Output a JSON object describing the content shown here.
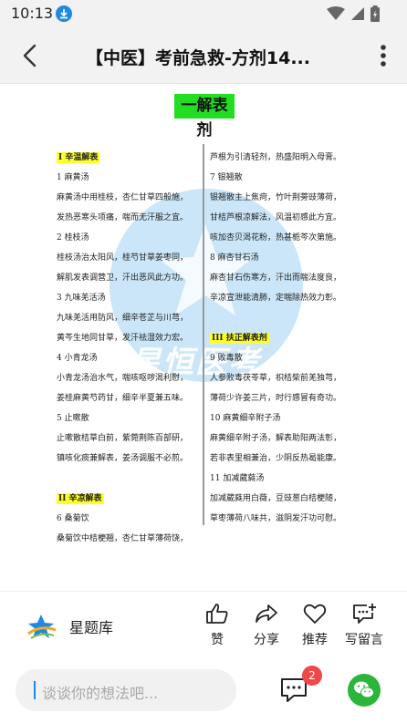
{
  "status_bar": {
    "time": "10:13"
  },
  "header": {
    "title": "【中医】考前急救-方剂14..."
  },
  "document": {
    "heading": "一解表剂",
    "watermark": "星恒医考",
    "left_column": [
      {
        "text": "I 辛温解表",
        "highlight": true
      },
      {
        "text": "1 麻黄汤"
      },
      {
        "text": "麻黄汤中用桂枝，杏仁甘草四般施，"
      },
      {
        "text": "发热恶寒头项痛，喘而无汗服之宜。"
      },
      {
        "text": "2 桂枝汤"
      },
      {
        "text": "桂枝汤治太阳风，桂芍甘草姜枣同，"
      },
      {
        "text": "解肌发表调营卫，汗出恶风此方功。"
      },
      {
        "text": "3 九味羌活汤"
      },
      {
        "text": "九味羌活用防风，细辛苍芷与川芎，"
      },
      {
        "text": "黄芩生地同甘草，发汗祛湿效力宏。"
      },
      {
        "text": "4 小青龙汤"
      },
      {
        "text": "小青龙汤治水气，喘咳呕哕渴利慰，"
      },
      {
        "text": "姜桂麻黄芍药甘，细辛半夏兼五味。"
      },
      {
        "text": "5 止嗽散"
      },
      {
        "text": "止嗽散桔草白前，紫菀荆陈百部研，"
      },
      {
        "text": "镇咳化痰兼解表，姜汤调服不必煎。"
      },
      {
        "text": "",
        "spacer": true
      },
      {
        "text": "II 辛凉解表",
        "highlight": true
      },
      {
        "text": "6 桑菊饮"
      },
      {
        "text": "桑菊饮中桔梗翘，杏仁甘草薄荷饶，"
      }
    ],
    "right_column": [
      {
        "text": "芦根为引清轻剂，热盛阳明入母膏。"
      },
      {
        "text": "7 银翘散"
      },
      {
        "text": "银翘散主上焦疴，竹叶荆蒡豉薄荷，"
      },
      {
        "text": "甘桔芦根凉解法，风温初感此方宜。"
      },
      {
        "text": "咳加杏贝渴花粉，热甚栀芩次第施。"
      },
      {
        "text": "8 麻杏甘石汤"
      },
      {
        "text": "麻杏甘石伤寒方，汗出而喘法度良，"
      },
      {
        "text": "辛凉宣泄能清肺，定喘除热效力彰。"
      },
      {
        "text": "",
        "spacer": true
      },
      {
        "text": "III 扶正解表剂",
        "highlight": true
      },
      {
        "text": "9 败毒散"
      },
      {
        "text": "人参败毒茯苓草，枳桔柴前羌独芎，"
      },
      {
        "text": "薄荷少许姜三片，时行感冒有奇功。"
      },
      {
        "text": "10 麻黄细辛附子汤"
      },
      {
        "text": "麻黄细辛附子汤，解表助阳两法彰，"
      },
      {
        "text": "若非表里相兼治，少阴反热曷能康。"
      },
      {
        "text": "11 加减葳蕤汤"
      },
      {
        "text": "加减葳蕤用白薇，豆豉葱白桔梗随，"
      },
      {
        "text": "草枣薄荷八味共，滋阴发汗功可慰。"
      }
    ]
  },
  "actions": {
    "brand_name": "星题库",
    "like": "赞",
    "share": "分享",
    "recommend": "推荐",
    "write_comment": "写留言"
  },
  "comment_bar": {
    "placeholder": "谈谈你的想法吧...",
    "comment_count": "2"
  },
  "colors": {
    "heading_bg": "#22dd22",
    "highlight": "#ffff2a",
    "accent": "#1e88e5",
    "badge": "#f04848",
    "wechat": "#2bb53a"
  }
}
